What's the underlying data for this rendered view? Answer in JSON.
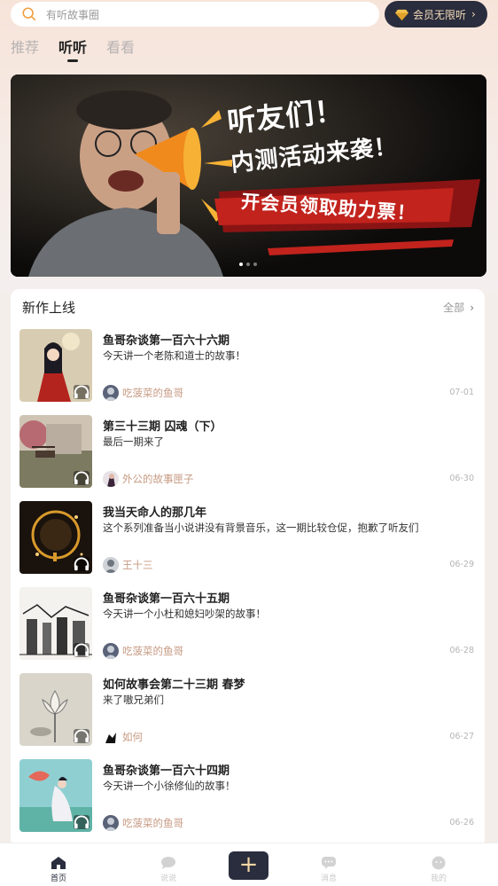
{
  "search": {
    "placeholder": "有听故事圈"
  },
  "vip": {
    "label": "会员无限听"
  },
  "tabs": [
    {
      "label": "推荐"
    },
    {
      "label": "听听"
    },
    {
      "label": "看看"
    }
  ],
  "banner": {
    "line1": "听友们！",
    "line2": "内测活动来袭！",
    "line3": "开会员领取助力票！"
  },
  "section": {
    "title": "新作上线",
    "all_label": "全部"
  },
  "items": [
    {
      "title": "鱼哥杂谈第一百六十六期",
      "desc": "今天讲一个老陈和道士的故事！",
      "author": "吃菠菜的鱼哥",
      "date": "07-01"
    },
    {
      "title": "第三十三期 囚魂（下）",
      "desc": "最后一期来了",
      "author": "外公的故事匣子",
      "date": "06-30"
    },
    {
      "title": "我当天命人的那几年",
      "desc": "这个系列准备当小说讲没有背景音乐，这一期比较仓促，抱歉了听友们",
      "author": "王十三",
      "date": "06-29"
    },
    {
      "title": "鱼哥杂谈第一百六十五期",
      "desc": "今天讲一个小杜和媳妇吵架的故事！",
      "author": "吃菠菜的鱼哥",
      "date": "06-28"
    },
    {
      "title": "如何故事会第二十三期 春梦",
      "desc": "来了嗷兄弟们",
      "author": "如何",
      "date": "06-27"
    },
    {
      "title": "鱼哥杂谈第一百六十四期",
      "desc": "今天讲一个小徐修仙的故事！",
      "author": "吃菠菜的鱼哥",
      "date": "06-26"
    }
  ],
  "bottom_nav": [
    {
      "label": "首页"
    },
    {
      "label": "说说"
    },
    {
      "label": "消息"
    },
    {
      "label": "我的"
    }
  ],
  "colors": {
    "accent": "#2a2d3d",
    "gold": "#f1d9b7",
    "author": "#c79a83"
  }
}
